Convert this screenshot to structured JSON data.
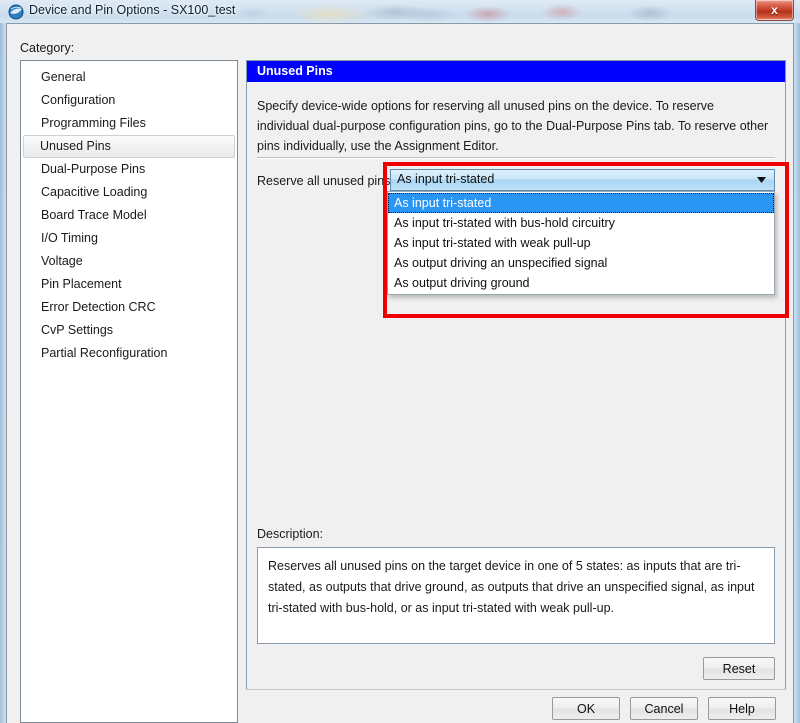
{
  "window": {
    "title": "Device and Pin Options - SX100_test",
    "icon": "quartus-globe-icon",
    "close_label": "x"
  },
  "category": {
    "label": "Category:",
    "selected": "Unused Pins",
    "items": [
      "General",
      "Configuration",
      "Programming Files",
      "Unused Pins",
      "Dual-Purpose Pins",
      "Capacitive Loading",
      "Board Trace Model",
      "I/O Timing",
      "Voltage",
      "Pin Placement",
      "Error Detection CRC",
      "CvP Settings",
      "Partial Reconfiguration"
    ]
  },
  "panel": {
    "header": "Unused Pins",
    "description": "Specify device-wide options for reserving all unused pins on the device. To reserve individual dual-purpose configuration pins, go to the Dual-Purpose Pins tab. To reserve other pins individually, use the Assignment Editor.",
    "reserve_label": "Reserve all unused pins:",
    "combo": {
      "value": "As input tri-stated",
      "arrow_icon": "chevron-down-icon",
      "expanded": true,
      "options": [
        "As input tri-stated",
        "As input tri-stated with bus-hold circuitry",
        "As input tri-stated with weak pull-up",
        "As output driving an unspecified signal",
        "As output driving ground"
      ],
      "highlighted_index": 0
    }
  },
  "description_section": {
    "label": "Description:",
    "text": "Reserves all unused pins on the target device in one of 5 states: as inputs that are tri-stated, as outputs that drive ground, as outputs that drive an unspecified signal, as input tri-stated with bus-hold, or as input tri-stated with weak pull-up."
  },
  "buttons": {
    "reset": "Reset",
    "ok": "OK",
    "cancel": "Cancel",
    "help": "Help"
  },
  "annotation": {
    "highlight_color": "#ee0000"
  },
  "colors": {
    "panel_header_bg": "#0000ff",
    "selection_blue": "#2a95f2",
    "dialog_bg": "#eff0ef"
  }
}
